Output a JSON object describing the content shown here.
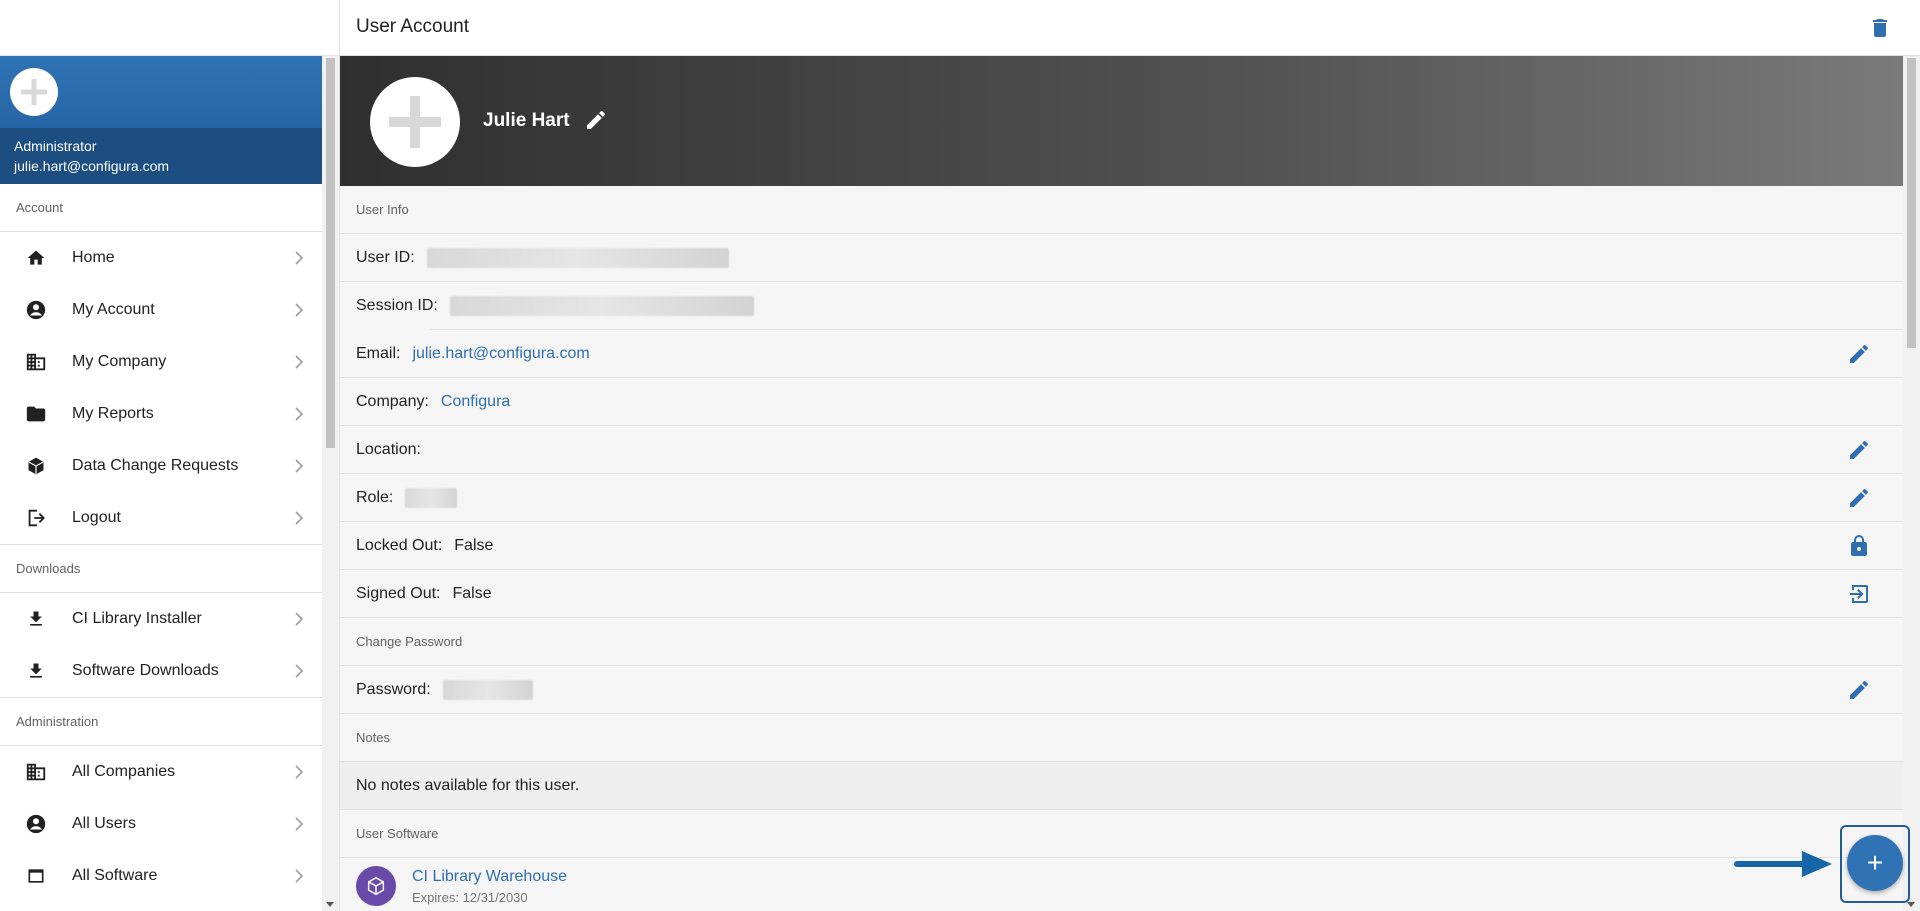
{
  "header": {
    "title": "User Account"
  },
  "sidebar": {
    "profile": {
      "role": "Administrator",
      "email": "julie.hart@configura.com"
    },
    "sections": [
      {
        "label": "Account",
        "items": [
          {
            "label": "Home",
            "icon": "home-icon"
          },
          {
            "label": "My Account",
            "icon": "account-circle-icon"
          },
          {
            "label": "My Company",
            "icon": "building-icon"
          },
          {
            "label": "My Reports",
            "icon": "folder-icon"
          },
          {
            "label": "Data Change Requests",
            "icon": "box-icon"
          },
          {
            "label": "Logout",
            "icon": "logout-icon"
          }
        ]
      },
      {
        "label": "Downloads",
        "items": [
          {
            "label": "CI Library Installer",
            "icon": "download-icon"
          },
          {
            "label": "Software Downloads",
            "icon": "download-icon"
          }
        ]
      },
      {
        "label": "Administration",
        "items": [
          {
            "label": "All Companies",
            "icon": "building-icon"
          },
          {
            "label": "All Users",
            "icon": "account-circle-icon"
          },
          {
            "label": "All Software",
            "icon": "window-icon"
          }
        ]
      }
    ]
  },
  "hero": {
    "name": "Julie Hart"
  },
  "user_info": {
    "label": "User Info",
    "user_id_label": "User ID:",
    "session_id_label": "Session ID:",
    "email_label": "Email:",
    "email": "julie.hart@configura.com",
    "company_label": "Company:",
    "company": "Configura",
    "location_label": "Location:",
    "role_label": "Role:",
    "locked_label": "Locked Out:",
    "locked": "False",
    "signed_label": "Signed Out:",
    "signed": "False"
  },
  "password_section": {
    "label": "Change Password",
    "password_label": "Password:"
  },
  "notes": {
    "label": "Notes",
    "text": "No notes available for this user."
  },
  "software": {
    "label": "User Software",
    "items": [
      {
        "name": "CI Library Warehouse",
        "expires": "Expires: 12/31/2030"
      }
    ]
  },
  "fab": {
    "label": "+"
  },
  "colors": {
    "accent": "#2f73b5",
    "link": "#2f6fae",
    "sidebar_band": "#1c4e82"
  }
}
